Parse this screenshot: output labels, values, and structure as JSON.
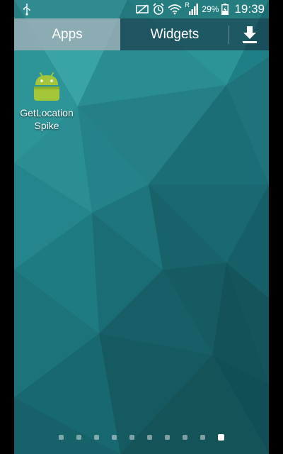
{
  "status_bar": {
    "icons": [
      "usb-icon",
      "mute-icon",
      "alarm-icon",
      "wifi-icon",
      "roaming-signal-icon",
      "battery-icon"
    ],
    "roaming_indicator": "R",
    "battery_percent": "29%",
    "time": "19:39"
  },
  "tabs": {
    "apps_label": "Apps",
    "widgets_label": "Widgets",
    "active": "Apps",
    "download_icon": "download-icon"
  },
  "apps": [
    {
      "label": "GetLocationSpike",
      "icon": "android-icon",
      "color": "#a4c639"
    }
  ],
  "page_indicator": {
    "total_pages": 10,
    "current_page": 10
  },
  "colors": {
    "wallpaper_base": "#1f7f86",
    "tab_active_bg": "#c9d6dc",
    "android_green": "#a4c639"
  }
}
